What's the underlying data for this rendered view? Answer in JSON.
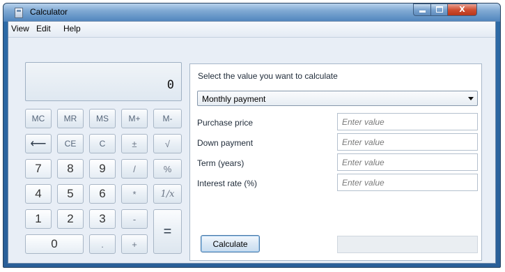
{
  "window": {
    "title": "Calculator",
    "icon": "calculator-icon",
    "controls": [
      "minimize-icon",
      "maximize-icon",
      "close-icon"
    ],
    "close_glyph": "X"
  },
  "menu": {
    "view": "View",
    "edit": "Edit",
    "help": "Help"
  },
  "display": {
    "value": "0"
  },
  "keys": {
    "mc": "MC",
    "mr": "MR",
    "ms": "MS",
    "mplus": "M+",
    "mminus": "M-",
    "backspace": "⟵",
    "ce": "CE",
    "c": "C",
    "plusminus": "±",
    "sqrt": "√",
    "seven": "7",
    "eight": "8",
    "nine": "9",
    "divide": "/",
    "percent": "%",
    "four": "4",
    "five": "5",
    "six": "6",
    "multiply": "*",
    "reciprocal": "1/x",
    "one": "1",
    "two": "2",
    "three": "3",
    "minus": "-",
    "equals": "=",
    "zero": "0",
    "decimal": ".",
    "plus": "+"
  },
  "panel": {
    "heading": "Select the value you want to calculate",
    "select_value": "Monthly payment",
    "fields": [
      {
        "label": "Purchase price",
        "placeholder": "Enter value"
      },
      {
        "label": "Down payment",
        "placeholder": "Enter value"
      },
      {
        "label": "Term (years)",
        "placeholder": "Enter value"
      },
      {
        "label": "Interest rate (%)",
        "placeholder": "Enter value"
      }
    ],
    "calculate_label": "Calculate"
  }
}
